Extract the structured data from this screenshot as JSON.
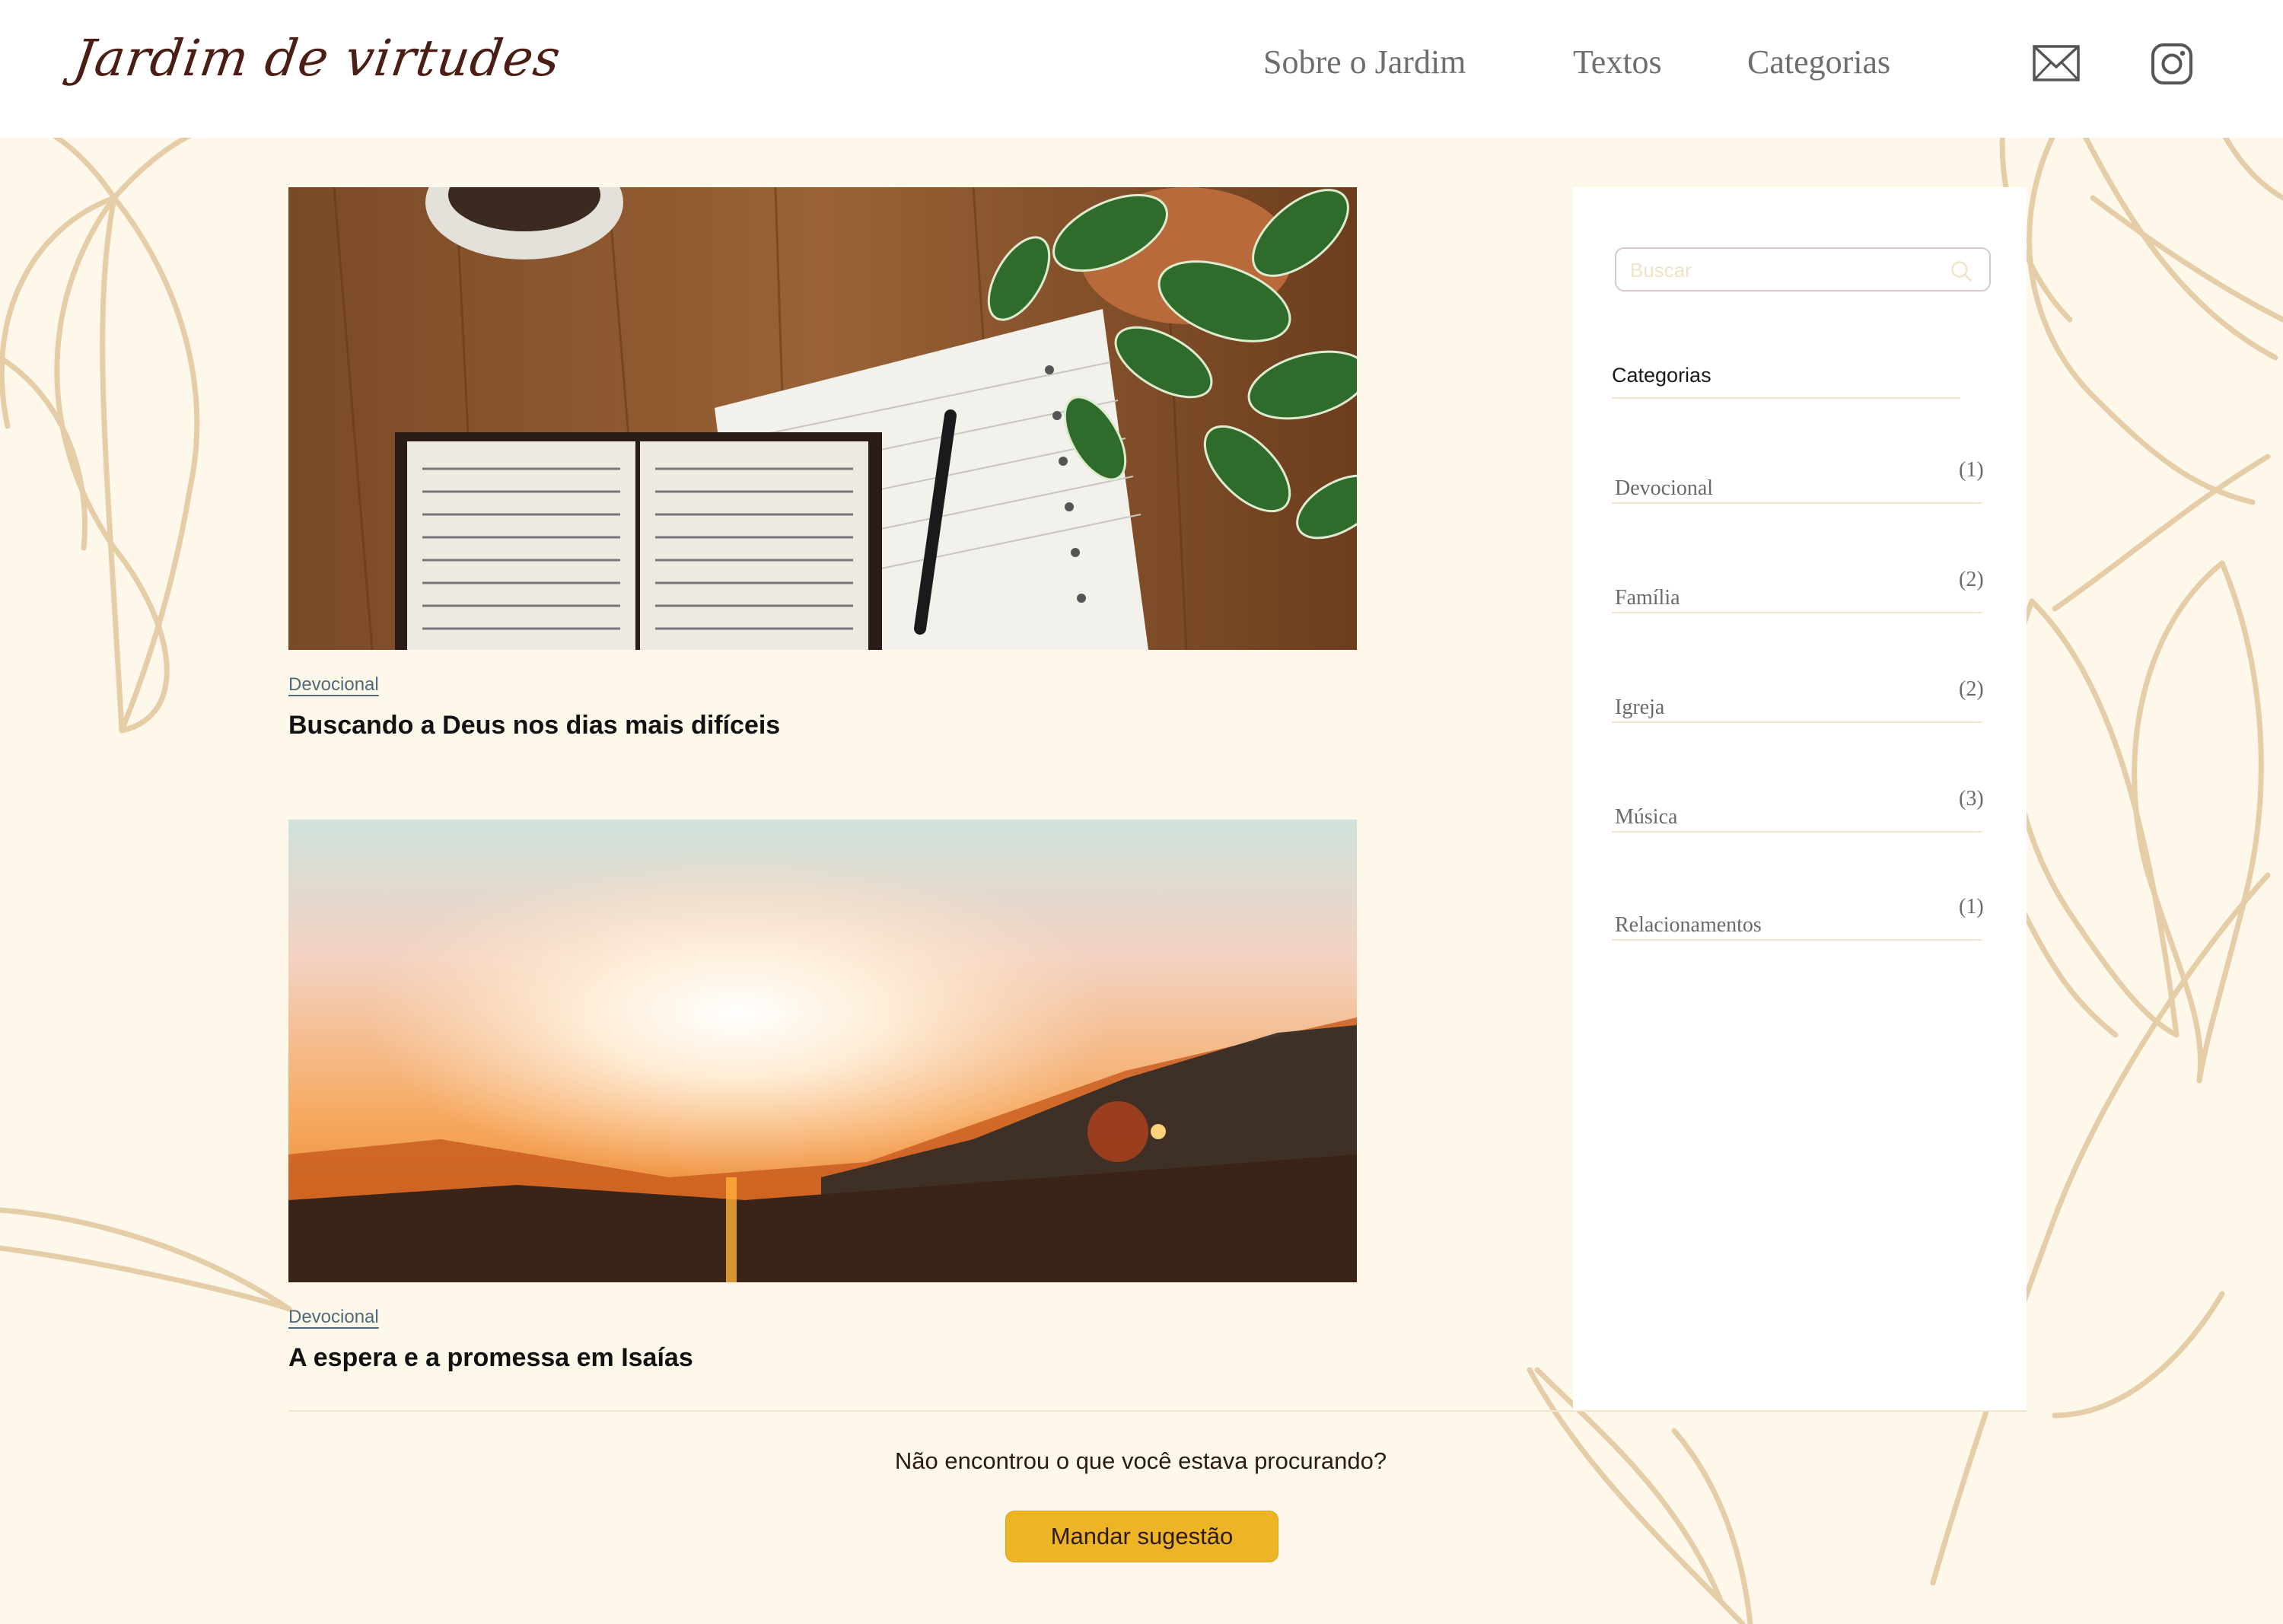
{
  "header": {
    "logo_text": "Jardim de virtudes",
    "nav": [
      {
        "label": "Sobre o Jardim"
      },
      {
        "label": "Textos"
      },
      {
        "label": "Categorias"
      }
    ],
    "icons": [
      "mail-icon",
      "instagram-icon"
    ]
  },
  "posts": [
    {
      "category": "Devocional",
      "title": "Buscando a Deus nos dias mais difíceis",
      "image": "open-bible-notebook-plant-photo"
    },
    {
      "category": "Devocional",
      "title": "A espera e a promessa em Isaías",
      "image": "sunrise-over-hills-photo"
    }
  ],
  "sidebar": {
    "search_placeholder": "Buscar",
    "categories_heading": "Categorias",
    "categories": [
      {
        "name": "Devocional",
        "count": "(1)"
      },
      {
        "name": "Família",
        "count": "(2)"
      },
      {
        "name": "Igreja",
        "count": "(2)"
      },
      {
        "name": "Música",
        "count": "(3)"
      },
      {
        "name": "Relacionamentos",
        "count": "(1)"
      }
    ]
  },
  "footer": {
    "prompt": "Não encontrou o que você estava procurando?",
    "button_label": "Mandar sugestão"
  },
  "colors": {
    "background": "#FDF8EA",
    "header": "#FFFFFF",
    "accent_button": "#EDB525",
    "floral_lines": "#E3C9A2",
    "logo": "#4A1E14"
  }
}
